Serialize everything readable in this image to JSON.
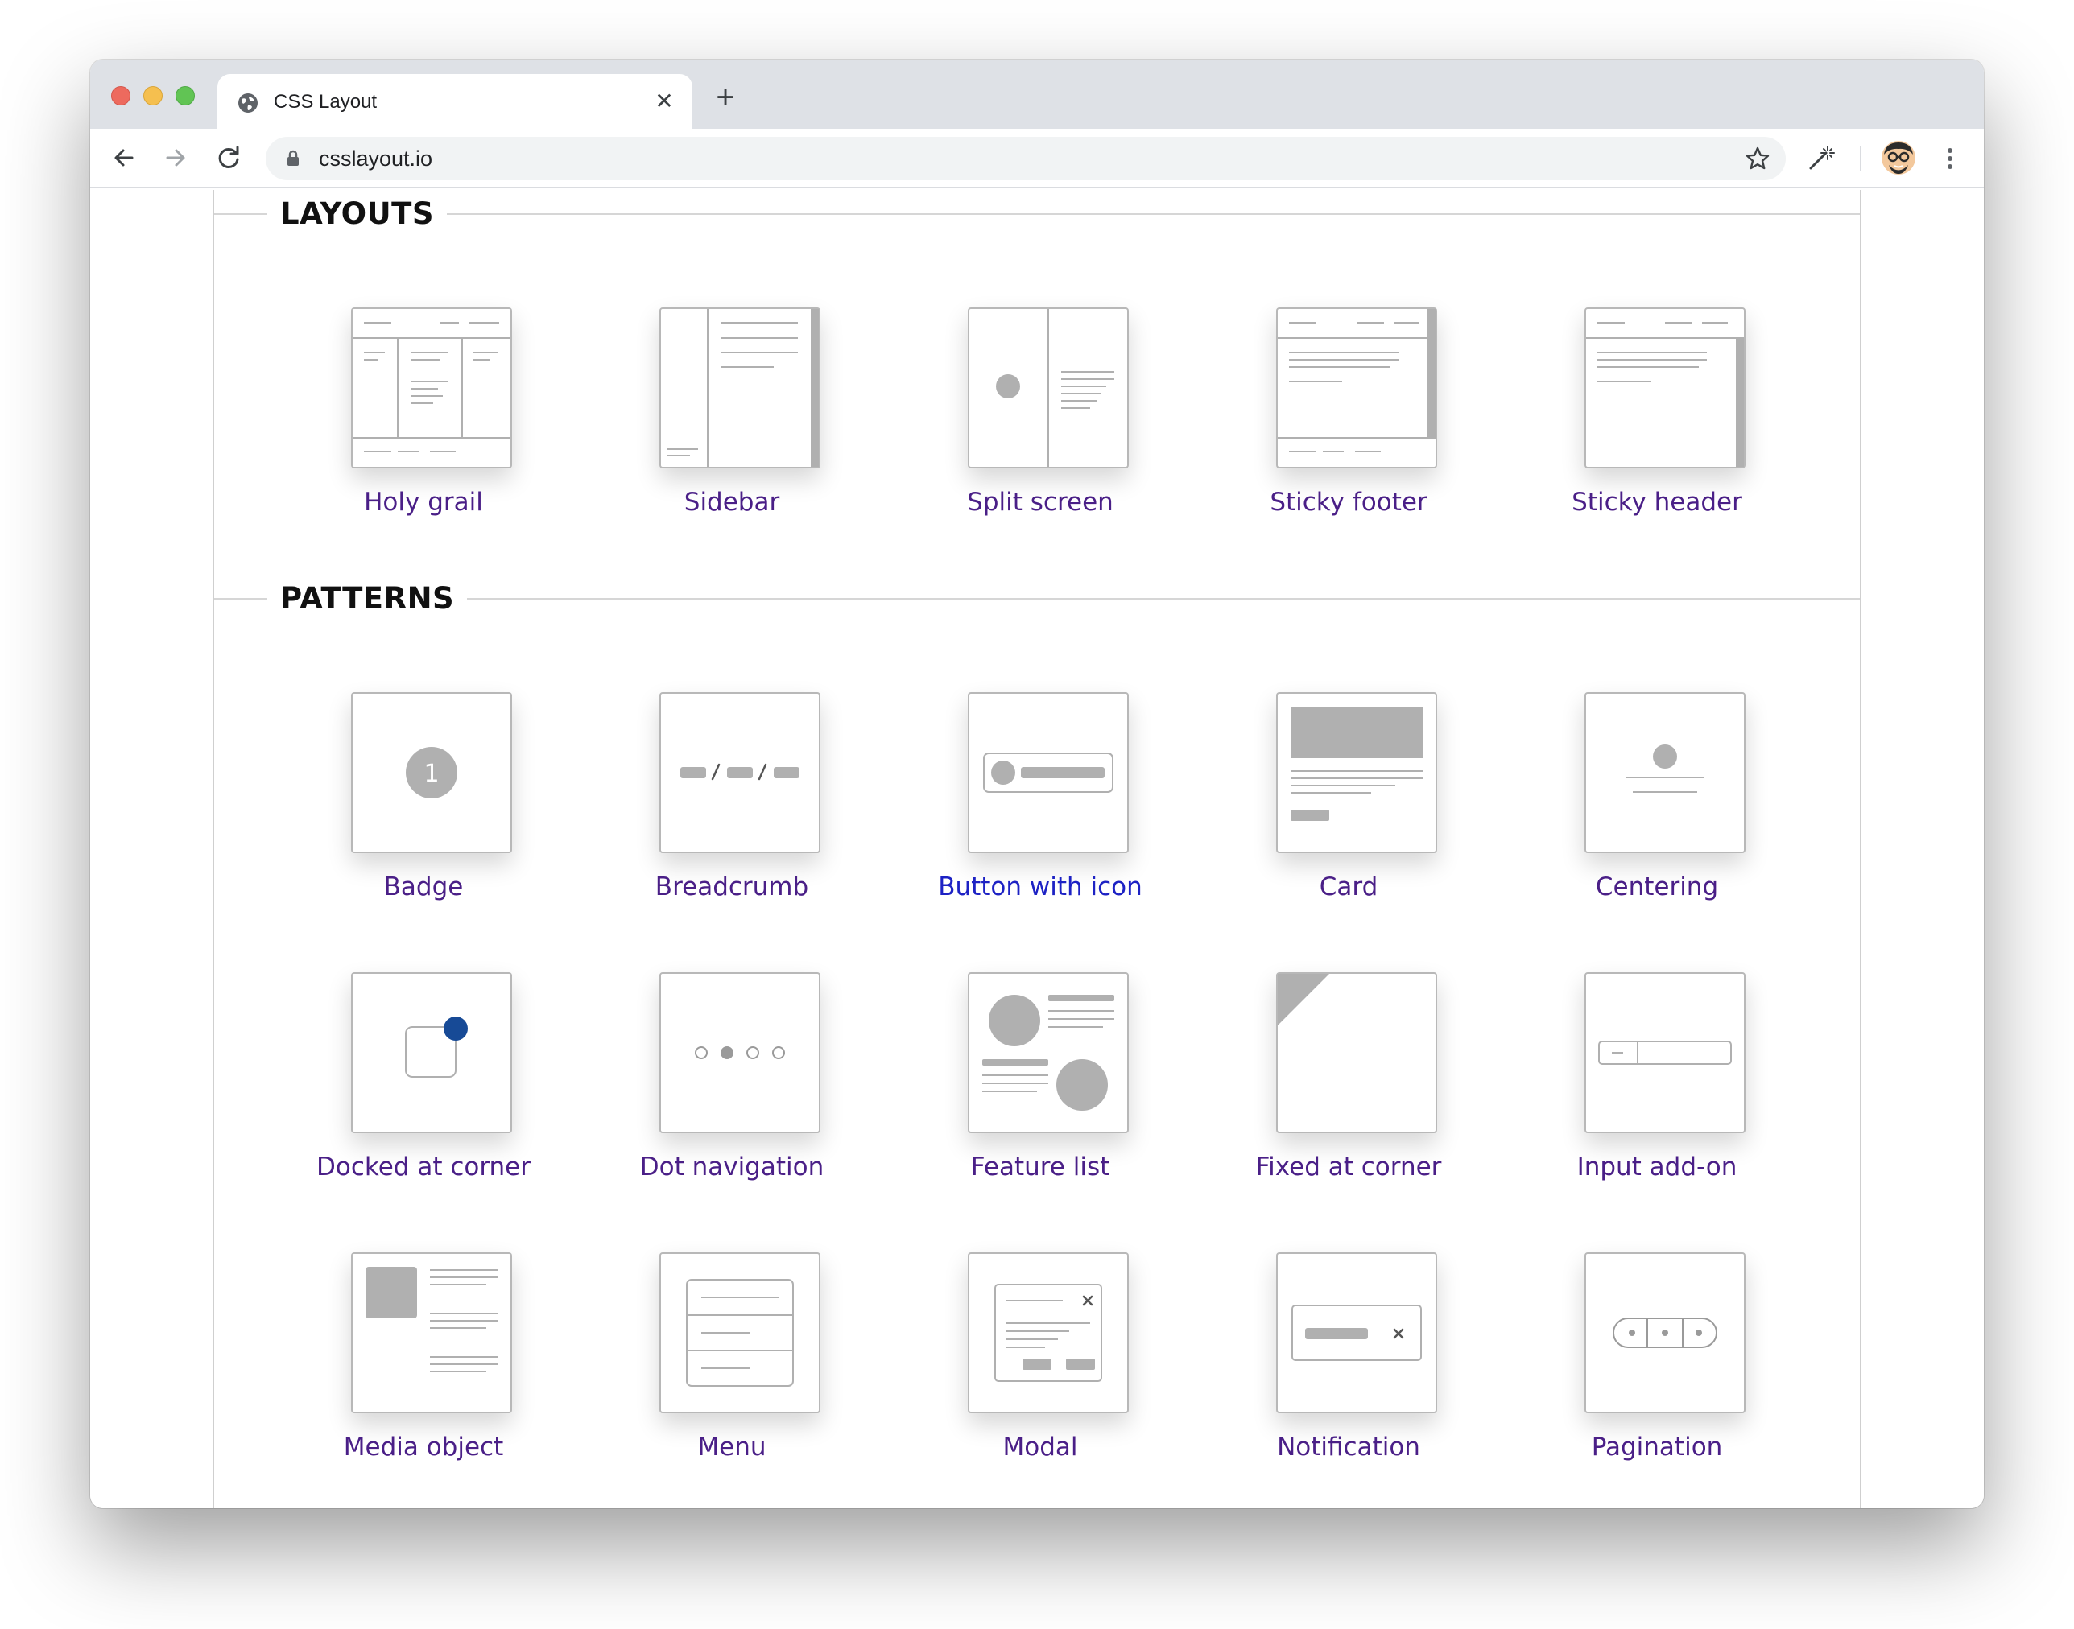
{
  "browser": {
    "tab_title": "CSS Layout",
    "tab_close_glyph": "✕",
    "new_tab_glyph": "+",
    "url": "csslayout.io",
    "icons": [
      "globe-icon",
      "back-arrow-icon",
      "forward-arrow-icon",
      "reload-icon",
      "lock-icon",
      "star-icon",
      "magic-wand-icon",
      "avatar",
      "more-vert-icon"
    ]
  },
  "sections": [
    {
      "title": "LAYOUTS",
      "items": [
        "Holy grail",
        "Sidebar",
        "Split screen",
        "Sticky footer",
        "Sticky header"
      ]
    },
    {
      "title": "PATTERNS",
      "items": [
        "Badge",
        "Breadcrumb",
        "Button with icon",
        "Card",
        "Centering",
        "Docked at corner",
        "Dot navigation",
        "Feature list",
        "Fixed at corner",
        "Input add-on",
        "Media object",
        "Menu",
        "Modal",
        "Notification",
        "Pagination"
      ]
    }
  ],
  "badge_number": "1",
  "colors": {
    "link": "#4a1f87",
    "link_hover": "#1d22c4",
    "accent_dot": "#174a96",
    "placeholder_gray": "#b0b0b0"
  }
}
